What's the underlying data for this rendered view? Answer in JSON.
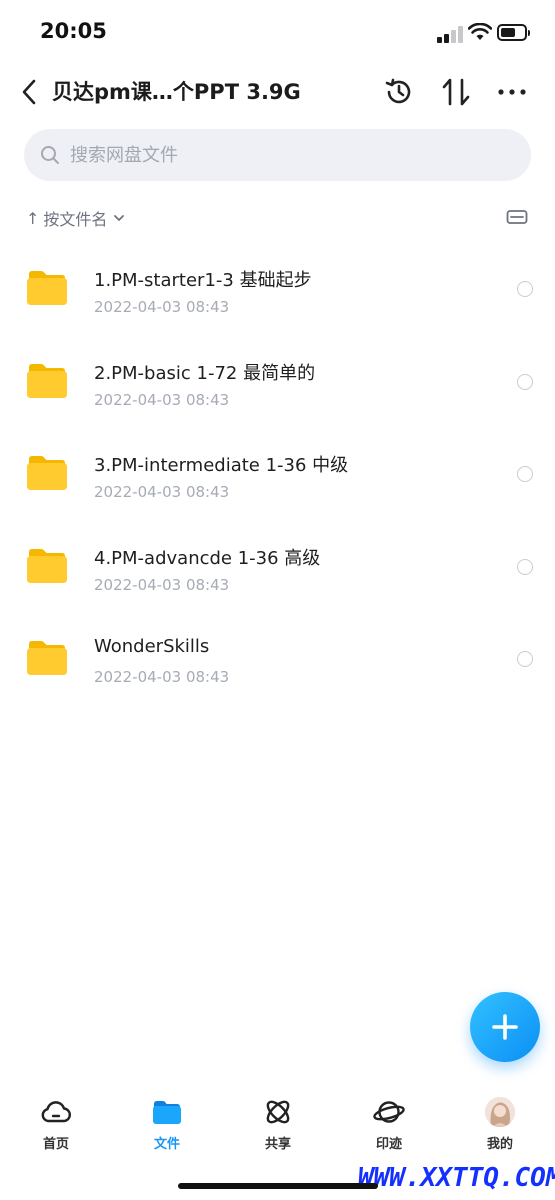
{
  "status_bar": {
    "time": "20:05"
  },
  "header": {
    "title": "贝达pm课…个PPT 3.9G"
  },
  "search": {
    "placeholder": "搜索网盘文件",
    "value": ""
  },
  "sort": {
    "label": "按文件名"
  },
  "files": [
    {
      "name": "1.PM-starter1-3 基础起步",
      "date": "2022-04-03 08:43"
    },
    {
      "name": "2.PM-basic 1-72 最简单的",
      "date": "2022-04-03 08:43"
    },
    {
      "name": "3.PM-intermediate 1-36 中级",
      "date": "2022-04-03 08:43"
    },
    {
      "name": "4.PM-advancde 1-36 高级",
      "date": "2022-04-03 08:43"
    },
    {
      "name": "WonderSkills",
      "date": "2022-04-03 08:43"
    }
  ],
  "tabs": [
    {
      "label": "首页",
      "icon": "cloud-icon"
    },
    {
      "label": "文件",
      "icon": "folder-icon",
      "active": true
    },
    {
      "label": "共享",
      "icon": "atom-icon"
    },
    {
      "label": "印迹",
      "icon": "planet-icon"
    },
    {
      "label": "我的",
      "icon": "avatar"
    }
  ],
  "watermark": "WWW.XXTTQ.COM",
  "colors": {
    "accent": "#1a96f5",
    "folder": "#ffcb2f",
    "fab": "#1aa6fa"
  }
}
